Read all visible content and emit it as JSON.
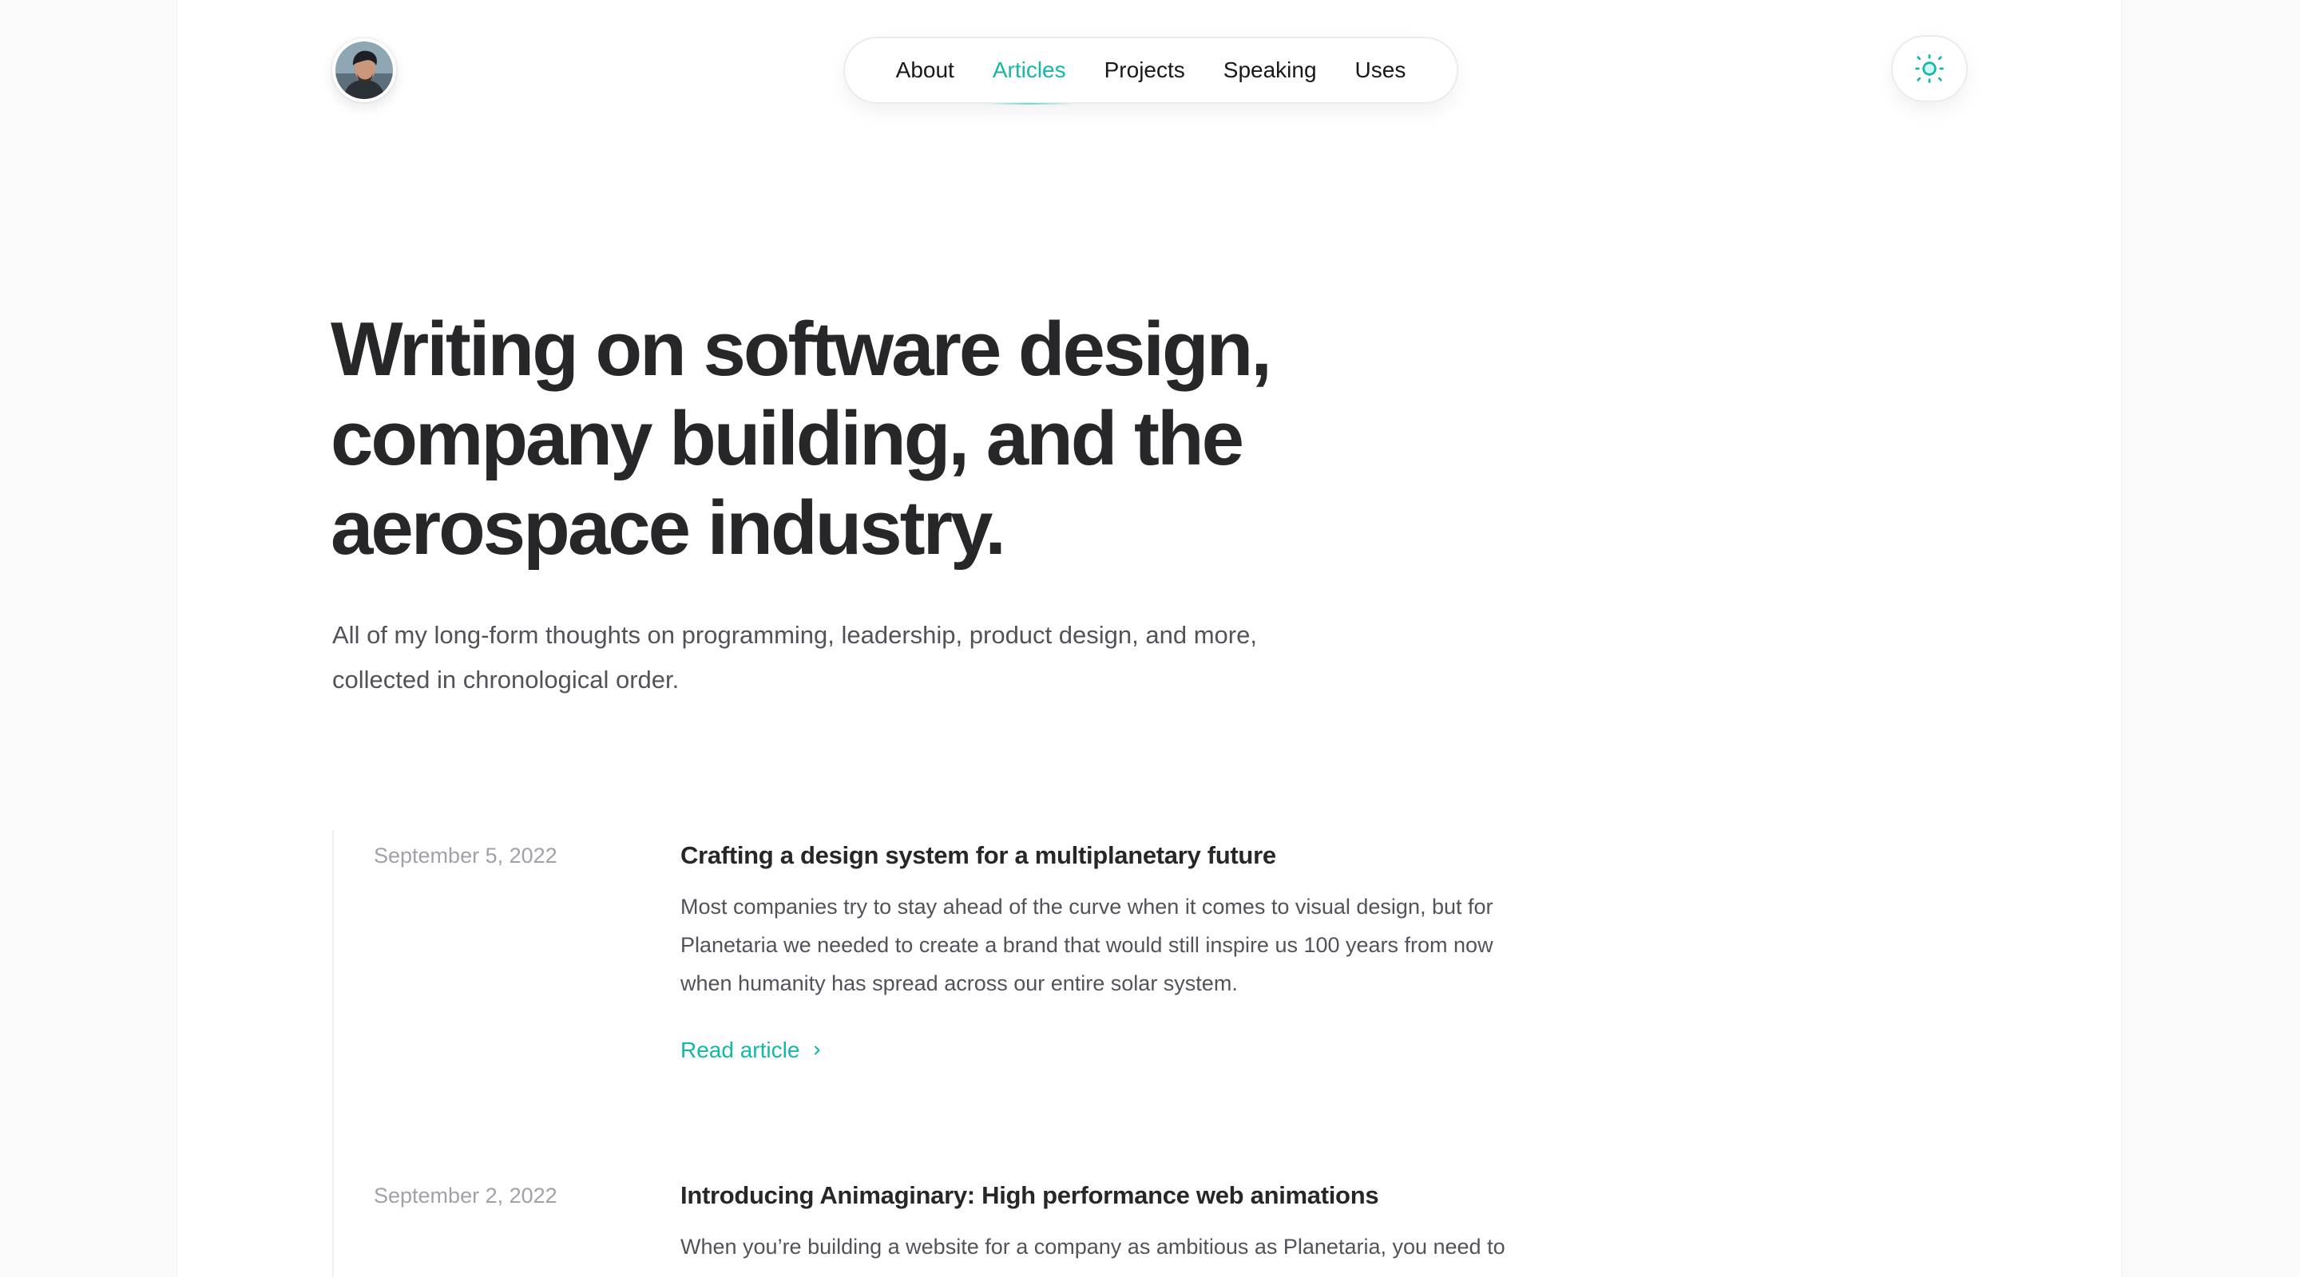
{
  "header": {
    "avatar_alt": "Author avatar",
    "nav": [
      {
        "label": "About",
        "active": false
      },
      {
        "label": "Articles",
        "active": true
      },
      {
        "label": "Projects",
        "active": false
      },
      {
        "label": "Speaking",
        "active": false
      },
      {
        "label": "Uses",
        "active": false
      }
    ],
    "theme_toggle_icon": "sun-icon"
  },
  "hero": {
    "title_lines": [
      "Writing on software design,",
      "company building, and the",
      "aerospace industry."
    ],
    "subtitle_lines": [
      "All of my long-form thoughts on programming, leadership, product design, and more,",
      "collected in chronological order."
    ]
  },
  "articles": [
    {
      "date": "September 5, 2022",
      "title": "Crafting a design system for a multiplanetary future",
      "description_lines": [
        "Most companies try to stay ahead of the curve when it comes to visual design, but for",
        "Planetaria we needed to create a brand that would still inspire us 100 years from now",
        "when humanity has spread across our entire solar system."
      ],
      "cta": "Read article",
      "cta_icon": "chevron-right-icon"
    },
    {
      "date": "September 2, 2022",
      "title": "Introducing Animaginary: High performance web animations",
      "description_lines": [
        "When you’re building a website for a company as ambitious as Planetaria, you need to"
      ]
    }
  ],
  "colors": {
    "accent": "#14b8a6",
    "heading": "#27272a",
    "body": "#52525b",
    "muted": "#a1a1aa",
    "background": "#fafafa",
    "card": "#ffffff"
  }
}
